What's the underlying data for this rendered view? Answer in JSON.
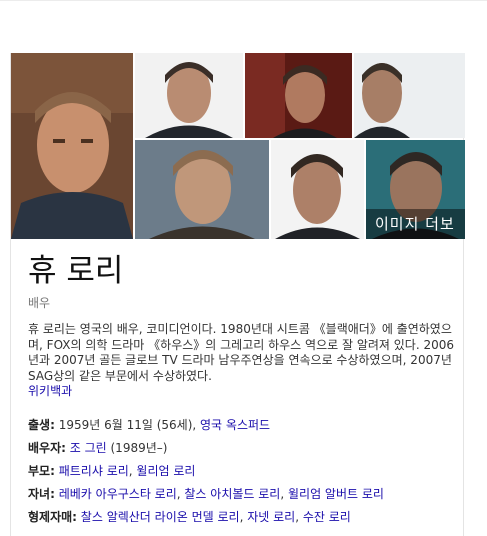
{
  "more_images_label": "이미지 더보기",
  "person": {
    "name": "휴 로리",
    "type": "배우",
    "description": "휴 로리는 영국의 배우, 코미디언이다. 1980년대 시트콤 《블랙애더》에 출연하였으며, FOX의 의학 드라마 《하우스》의 그레고리 하우스 역으로 잘 알려져 있다. 2006년과 2007년 골든 글로브 TV 드라마 남우주연상을 연속으로 수상하였으며, 2007년 SAG상의 같은 부문에서 수상하였다.",
    "source_link": "위키백과"
  },
  "facts": {
    "born": {
      "label": "출생:",
      "text": " 1959년 6월 11일 (56세), ",
      "link": "영국 옥스퍼드"
    },
    "spouse": {
      "label": "배우자:",
      "link": "조 그린",
      "text": " (1989년–)"
    },
    "parents": {
      "label": "부모:",
      "links": [
        "패트리샤 로리",
        "윌리엄 로리"
      ]
    },
    "children": {
      "label": "자녀:",
      "links": [
        "레베카 아우구스타 로리",
        "찰스 아치볼드 로리",
        "윌리엄 알버트 로리"
      ]
    },
    "siblings": {
      "label": "형제자매:",
      "links": [
        "찰스 알렉산더 라이온 먼델 로리",
        "자넷 로리",
        "수잔 로리"
      ]
    }
  },
  "colors": {
    "link": "#1a0dab",
    "label": "#222222",
    "muted": "#777777"
  }
}
